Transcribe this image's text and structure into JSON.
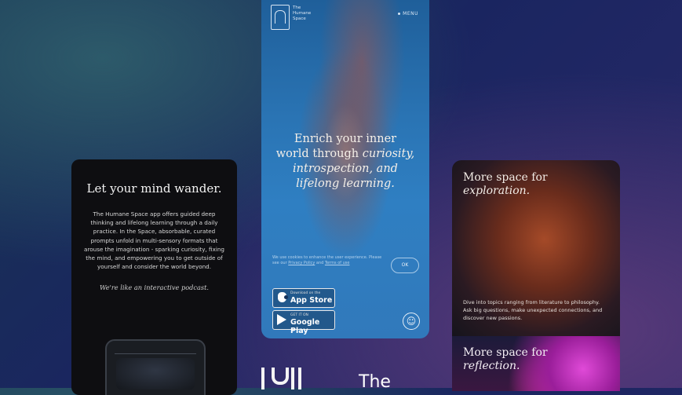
{
  "left_card": {
    "title": "Let your mind wander.",
    "body": "The Humane Space app offers guided deep thinking and lifelong learning through a daily practice. In the Space, absorbable, curated prompts unfold in multi-sensory formats that arouse the imagination - sparking curiosity, fixing the mind, and empowering you to get outside of yourself and consider the world beyond.",
    "podcast": "We're like an interactive podcast."
  },
  "center_card": {
    "logo_line1": "The",
    "logo_line2": "Humane",
    "logo_line3": "Space",
    "menu": "MENU",
    "headline_line1": "Enrich your inner",
    "headline_line2a": "world through ",
    "headline_line2b": "curiosity,",
    "headline_line3": "introspection, and",
    "headline_line4": "lifelong learning.",
    "consent_text": "We use cookies to enhance the user experience. Please see our ",
    "consent_link1": "Privacy Policy",
    "consent_mid": " and ",
    "consent_link2": "Terms of use",
    "ok_label": "OK",
    "app_store_small": "Download on the",
    "app_store_big": "App Store",
    "google_play_small": "GET IT ON",
    "google_play_big": "Google Play",
    "accessibility_glyph": "☺"
  },
  "bottom_logo": {
    "word": "The"
  },
  "right_card_1": {
    "title_line1": "More space for",
    "title_line2": "exploration.",
    "body": "Dive into topics ranging from literature to philosophy. Ask big questions, make unexpected connections, and discover new passions."
  },
  "right_card_2": {
    "title_line1": "More space for",
    "title_line2": "reflection."
  },
  "colors": {
    "background": "#1a2560",
    "center_card": "#2a74b4",
    "left_card": "#0e0e11",
    "right_card_accent": "#a54a28"
  }
}
